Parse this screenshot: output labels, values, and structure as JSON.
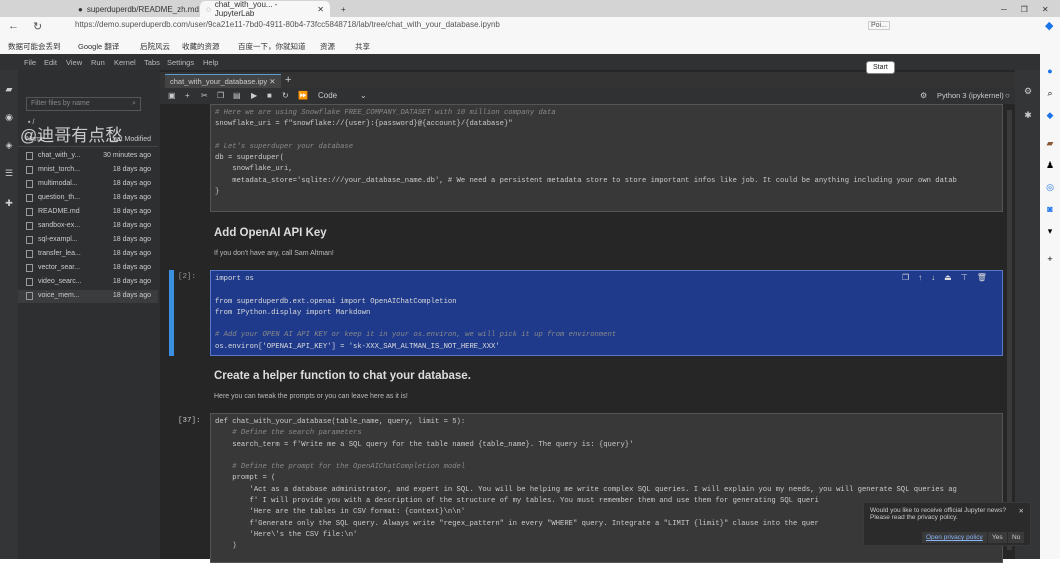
{
  "browser": {
    "tabs": [
      "superduperdb/README_zh.md",
      "chat_with_you... - JupyterLab"
    ],
    "url": "https://demo.superduperdb.com/user/9ca21e11-7bd0-4911-80b4-73fcc5848718/lab/tree/chat_with_your_database.ipynb",
    "bookmarks": [
      "数据可能会丢到",
      "Google 翻译",
      "后院风云",
      "收藏的资源",
      "百度一下，你就知道",
      "资源",
      "共享"
    ],
    "ext_label": "Poi...",
    "tooltip": "Start"
  },
  "watermark": "@迪哥有点愁",
  "menu": [
    "File",
    "Edit",
    "View",
    "Run",
    "Kernel",
    "Tabs",
    "Settings",
    "Help"
  ],
  "filebrowser": {
    "filter_placeholder": "Filter files by name",
    "path": "/",
    "col_name": "Name",
    "col_modified": "Last Modified",
    "files": [
      {
        "name": "chat_with_y...",
        "modified": "30 minutes ago"
      },
      {
        "name": "mnist_torch...",
        "modified": "18 days ago"
      },
      {
        "name": "multimodal...",
        "modified": "18 days ago"
      },
      {
        "name": "question_th...",
        "modified": "18 days ago"
      },
      {
        "name": "README.md",
        "modified": "18 days ago"
      },
      {
        "name": "sandbox-ex...",
        "modified": "18 days ago"
      },
      {
        "name": "sql-exampl...",
        "modified": "18 days ago"
      },
      {
        "name": "transfer_lea...",
        "modified": "18 days ago"
      },
      {
        "name": "vector_sear...",
        "modified": "18 days ago"
      },
      {
        "name": "video_searc...",
        "modified": "18 days ago"
      },
      {
        "name": "voice_mem...",
        "modified": "18 days ago"
      }
    ]
  },
  "notebook": {
    "tab": "chat_with_your_database.ipy",
    "cell_type": "Code",
    "kernel": "Python 3 (ipykernel)",
    "cell1": [
      "# Here we are using Snowflake FREE_COMPANY_DATASET with 10 million company data",
      "snowflake_uri = f\"snowflake://{user}:{password}@{account}/{database}\"",
      "",
      "# Let's superduper your database",
      "db = superduper(",
      "    snowflake_uri,",
      "    metadata_store='sqlite:///your_database_name.db', # We need a persistent metadata store to store important infos like job. It could be anything including your own datab",
      "}"
    ],
    "h1": "Add OpenAI API Key",
    "p1": "If you don't have any, call Sam Altman!",
    "prompt2": "[2]:",
    "cell2": [
      "import os",
      "",
      "from superduperdb.ext.openai import OpenAIChatCompletion",
      "from IPython.display import Markdown",
      "",
      "# Add your OPEN AI API KEY or keep it in your os.environ, we will pick it up from environment",
      "os.environ['OPENAI_API_KEY'] = 'sk-XXX_SAM_ALTMAN_IS_NOT_HERE_XXX'"
    ],
    "h2": "Create a helper function to chat your database.",
    "p2": "Here you can tweak the prompts or you can leave here as it is!",
    "prompt3": "[37]:",
    "cell3": [
      "def chat_with_your_database(table_name, query, limit = 5):",
      "    # Define the search parameters",
      "    search_term = f'Write me a SQL query for the table named {table_name}. The query is: {query}'",
      "",
      "    # Define the prompt for the OpenAIChatCompletion model",
      "    prompt = (",
      "        'Act as a database administrator, and expert in SQL. You will be helping me write complex SQL queries. I will explain you my needs, you will generate SQL queries ag",
      "        f' I will provide you with a description of the structure of my tables. You must remember them and use them for generating SQL queri",
      "        'Here are the tables in CSV format: {context}\\n\\n'",
      "        f'Generate only the SQL query. Always write \"regex_pattern\" in every \"WHERE\" query. Integrate a \"LIMIT {limit}\" clause into the quer",
      "        'Here\\'s the CSV file:\\n'",
      "    )"
    ]
  },
  "notification": {
    "line1": "Would you like to receive official Jupyter news?",
    "line2": "Please read the privacy policy.",
    "open": "Open privacy policy",
    "yes": "Yes",
    "no": "No"
  }
}
